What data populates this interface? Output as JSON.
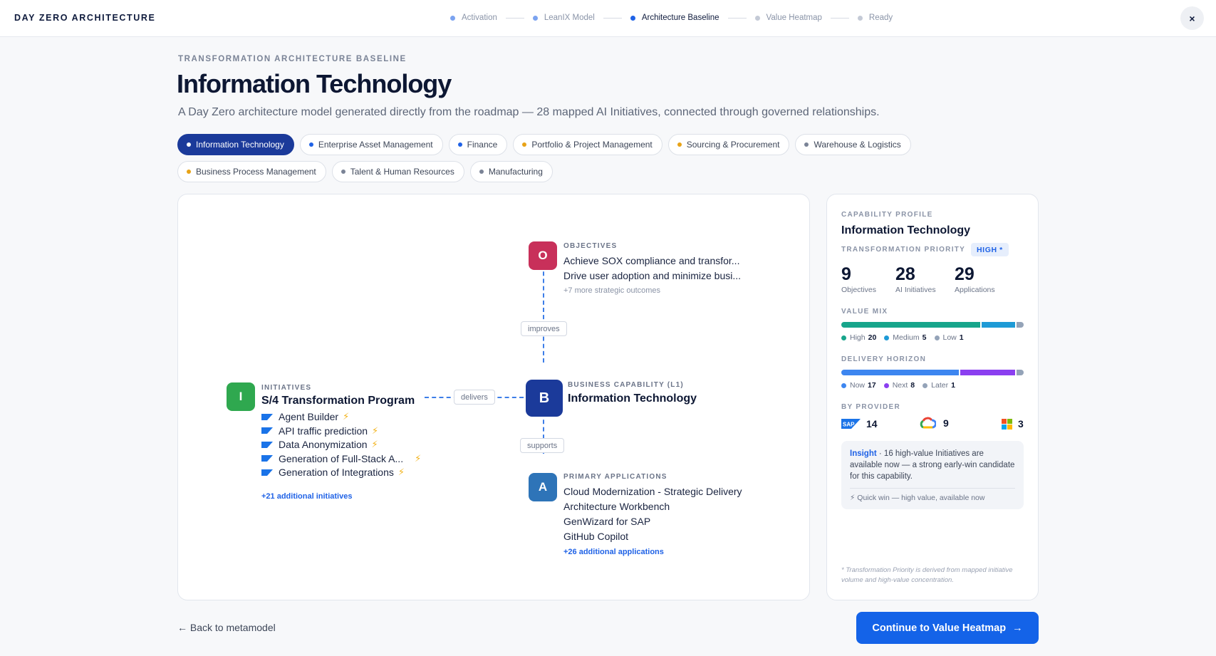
{
  "app": {
    "brand": "DAY ZERO ARCHITECTURE",
    "close_label": "×"
  },
  "stepper": [
    {
      "label": "Activation",
      "state": "done"
    },
    {
      "label": "LeanIX Model",
      "state": "done"
    },
    {
      "label": "Architecture Baseline",
      "state": "active"
    },
    {
      "label": "Value Heatmap",
      "state": "pending"
    },
    {
      "label": "Ready",
      "state": "pending"
    }
  ],
  "header": {
    "eyebrow": "TRANSFORMATION ARCHITECTURE BASELINE",
    "title": "Information Technology",
    "subtitle": "A Day Zero architecture model generated directly from the roadmap — 28 mapped AI Initiatives, connected through governed relationships."
  },
  "chips_row1": [
    {
      "label": "Information Technology",
      "color": "#1f62e6",
      "active": true
    },
    {
      "label": "Enterprise Asset Management",
      "color": "#1f62e6"
    },
    {
      "label": "Finance",
      "color": "#1f62e6"
    },
    {
      "label": "Portfolio & Project Management",
      "color": "#e8a317"
    },
    {
      "label": "Sourcing & Procurement",
      "color": "#e8a317"
    },
    {
      "label": "Warehouse & Logistics",
      "color": "#7a8396"
    }
  ],
  "chips_row2": [
    {
      "label": "Business Process Management",
      "color": "#e8a317"
    },
    {
      "label": "Talent & Human Resources",
      "color": "#7a8396"
    },
    {
      "label": "Manufacturing",
      "color": "#7a8396"
    }
  ],
  "diagram": {
    "objectives": {
      "icon": "O",
      "label": "OBJECTIVES",
      "items": [
        "Achieve SOX compliance and transfor...",
        "Drive user adoption and minimize busi..."
      ],
      "more": "+7 more strategic outcomes"
    },
    "capability": {
      "icon": "B",
      "label": "BUSINESS CAPABILITY (L1)",
      "name": "Information Technology"
    },
    "initiatives": {
      "icon": "I",
      "label": "INITIATIVES",
      "name": "S/4 Transformation Program",
      "items": [
        "Agent Builder",
        "API traffic prediction",
        "Data Anonymization",
        "Generation of Full-Stack A...",
        "Generation of Integrations"
      ],
      "more": "+21 additional initiatives"
    },
    "applications": {
      "icon": "A",
      "label": "PRIMARY APPLICATIONS",
      "items": [
        "Cloud Modernization - Strategic Delivery",
        "Architecture Workbench",
        "GenWizard for SAP",
        "GitHub Copilot"
      ],
      "more": "+26 additional applications"
    },
    "relations": {
      "improves": "improves",
      "delivers": "delivers",
      "supports": "supports"
    },
    "bolt": "⚡"
  },
  "profile": {
    "eyebrow": "CAPABILITY PROFILE",
    "title": "Information Technology",
    "priority_label": "TRANSFORMATION PRIORITY",
    "priority_value": "HIGH *",
    "stats": [
      {
        "num": "9",
        "caption": "Objectives"
      },
      {
        "num": "28",
        "caption": "AI Initiatives"
      },
      {
        "num": "29",
        "caption": "Applications"
      }
    ],
    "value_mix": {
      "label": "VALUE MIX",
      "segments": [
        {
          "name": "High",
          "value": 20,
          "color": "#17a58b"
        },
        {
          "name": "Medium",
          "value": 5,
          "color": "#1e9ad6"
        },
        {
          "name": "Low",
          "value": 1,
          "color": "#94a3b8"
        }
      ],
      "legend": [
        {
          "name": "High",
          "value": "20"
        },
        {
          "name": "Medium",
          "value": "5"
        },
        {
          "name": "Low",
          "value": "1"
        }
      ]
    },
    "delivery": {
      "label": "DELIVERY HORIZON",
      "segments": [
        {
          "name": "Now",
          "value": 17,
          "color": "#3d86f0"
        },
        {
          "name": "Next",
          "value": 8,
          "color": "#8b3ff0"
        },
        {
          "name": "Later",
          "value": 1,
          "color": "#94a3b8"
        }
      ],
      "legend": [
        {
          "name": "Now",
          "value": "17"
        },
        {
          "name": "Next",
          "value": "8"
        },
        {
          "name": "Later",
          "value": "1"
        }
      ]
    },
    "provider_label": "BY PROVIDER",
    "providers": [
      {
        "name": "sap-logo",
        "count": "14"
      },
      {
        "name": "google-cloud-logo",
        "count": "9"
      },
      {
        "name": "microsoft-logo",
        "count": "3"
      }
    ],
    "insight": {
      "title": "Insight",
      "text": " · 16 high-value Initiatives are available now — a strong early-win candidate for this capability.",
      "quickwin": "⚡ Quick win — high value, available now"
    },
    "footnote": "* Transformation Priority is derived from mapped initiative volume and high-value concentration."
  },
  "footer": {
    "back": "← Back to metamodel",
    "cta": "Continue to Value Heatmap",
    "cta_arrow": "→"
  }
}
